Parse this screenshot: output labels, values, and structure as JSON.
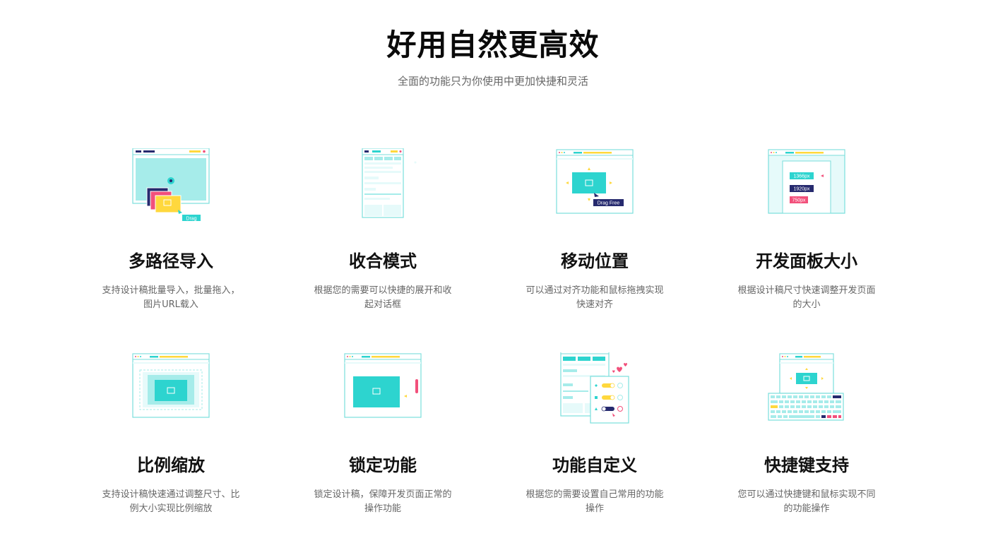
{
  "hero": {
    "title": "好用自然更高效",
    "subtitle": "全面的功能只为你使用中更加快捷和灵活"
  },
  "features": [
    {
      "title": "多路径导入",
      "desc": "支持设计稿批量导入，批量拖入，图片URL载入",
      "tag": "Drag"
    },
    {
      "title": "收合模式",
      "desc": "根据您的需要可以快捷的展开和收起对话框"
    },
    {
      "title": "移动位置",
      "desc": "可以通过对齐功能和鼠标拖拽实现快速对齐",
      "tag": "Drag Free"
    },
    {
      "title": "开发面板大小",
      "desc": "根据设计稿尺寸快速调整开发页面的大小",
      "sizes": [
        "1366px",
        "1920px",
        "750px"
      ]
    },
    {
      "title": "比例缩放",
      "desc": "支持设计稿快速通过调整尺寸、比例大小实现比例缩放"
    },
    {
      "title": "锁定功能",
      "desc": "锁定设计稿，保障开发页面正常的操作功能"
    },
    {
      "title": "功能自定义",
      "desc": "根据您的需要设置自己常用的功能操作"
    },
    {
      "title": "快捷键支持",
      "desc": "您可以通过快捷键和鼠标实现不同的功能操作"
    }
  ],
  "colors": {
    "teal": "#2dd4cf",
    "teal_light": "#a6ecea",
    "teal_pale": "#e6fafa",
    "navy": "#262a6e",
    "yellow": "#ffd83d",
    "pink": "#f2507b",
    "outline": "#7adedb"
  }
}
